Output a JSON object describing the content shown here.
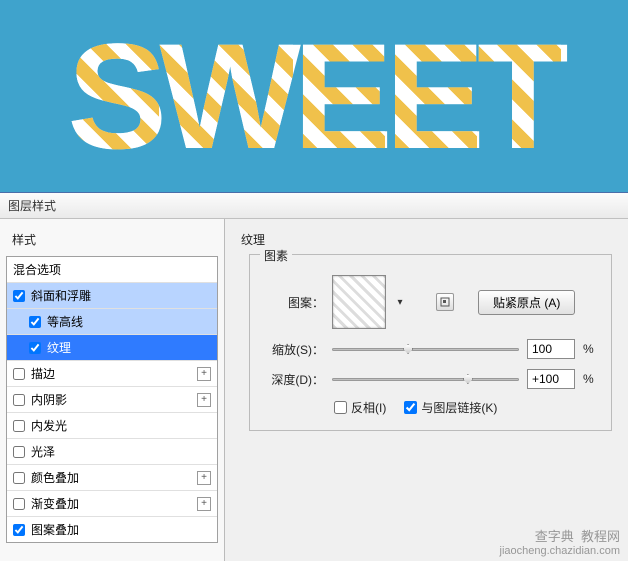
{
  "preview": {
    "text": "SWEET"
  },
  "dialog": {
    "title": "图层样式",
    "left": {
      "styles_label": "样式",
      "blend_label": "混合选项",
      "items": [
        {
          "label": "斜面和浮雕",
          "checked": true,
          "selected": true,
          "indent": false,
          "plus": false
        },
        {
          "label": "等高线",
          "checked": true,
          "selected": true,
          "indent": true,
          "plus": false
        },
        {
          "label": "纹理",
          "checked": true,
          "highlighted": true,
          "indent": true,
          "plus": false
        },
        {
          "label": "描边",
          "checked": false,
          "indent": false,
          "plus": true
        },
        {
          "label": "内阴影",
          "checked": false,
          "indent": false,
          "plus": true
        },
        {
          "label": "内发光",
          "checked": false,
          "indent": false,
          "plus": false
        },
        {
          "label": "光泽",
          "checked": false,
          "indent": false,
          "plus": false
        },
        {
          "label": "颜色叠加",
          "checked": false,
          "indent": false,
          "plus": true
        },
        {
          "label": "渐变叠加",
          "checked": false,
          "indent": false,
          "plus": true
        },
        {
          "label": "图案叠加",
          "checked": true,
          "indent": false,
          "plus": false
        }
      ]
    },
    "right": {
      "section_title": "纹理",
      "group_legend": "图素",
      "pattern_label": "图案：",
      "snap_button": "贴紧原点 (A)",
      "scale_label": "缩放(S)：",
      "scale_value": "100",
      "scale_unit": "%",
      "depth_label": "深度(D)：",
      "depth_value": "+100",
      "depth_unit": "%",
      "invert_label": "反相(I)",
      "invert_checked": false,
      "link_label": "与图层链接(K)",
      "link_checked": true
    }
  },
  "watermark": "查字典  教程网\njiaocheng.chazidian.com"
}
